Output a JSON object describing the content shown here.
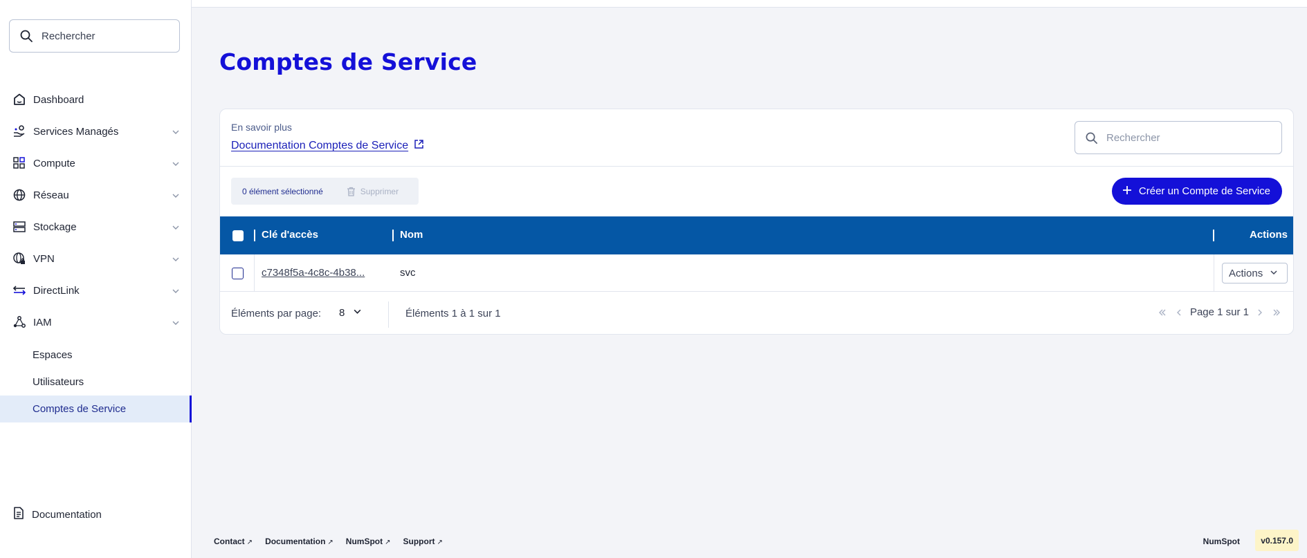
{
  "sidebar": {
    "search_placeholder": "Rechercher",
    "items": [
      {
        "label": "Dashboard",
        "icon": "home-icon",
        "expandable": false
      },
      {
        "label": "Services Managés",
        "icon": "managed-services-icon",
        "expandable": true
      },
      {
        "label": "Compute",
        "icon": "compute-icon",
        "expandable": true
      },
      {
        "label": "Réseau",
        "icon": "globe-icon",
        "expandable": true
      },
      {
        "label": "Stockage",
        "icon": "storage-icon",
        "expandable": true
      },
      {
        "label": "VPN",
        "icon": "vpn-icon",
        "expandable": true
      },
      {
        "label": "DirectLink",
        "icon": "directlink-icon",
        "expandable": true
      },
      {
        "label": "IAM",
        "icon": "iam-icon",
        "expandable": true
      }
    ],
    "iam_children": [
      "Espaces",
      "Utilisateurs",
      "Comptes de Service"
    ],
    "active_child": "Comptes de Service",
    "documentation_label": "Documentation"
  },
  "page": {
    "title": "Comptes de Service",
    "learn_more": "En savoir plus",
    "doc_link": "Documentation Comptes de Service",
    "search_placeholder": "Rechercher",
    "selection_count": "0 élément sélectionné",
    "delete_label": "Supprimer",
    "create_button": "Créer un Compte de Service"
  },
  "table": {
    "columns": [
      "Clé d'accès",
      "Nom",
      "Actions"
    ],
    "rows": [
      {
        "access_key": "c7348f5a-4c8c-4b38...",
        "name": "svc",
        "actions_label": "Actions"
      }
    ],
    "per_page_label": "Éléments par page:",
    "per_page_value": "8",
    "range_text": "Éléments 1 à 1 sur 1",
    "page_text": "Page 1 sur 1"
  },
  "footer": {
    "links": [
      "Contact",
      "Documentation",
      "NumSpot",
      "Support"
    ],
    "brand": "NumSpot",
    "version": "v0.157.0"
  },
  "colors": {
    "accent": "#1410d8",
    "table_header": "#0557a5",
    "active_bg": "#e3ecf9",
    "version_bg": "#fdf4c8"
  }
}
